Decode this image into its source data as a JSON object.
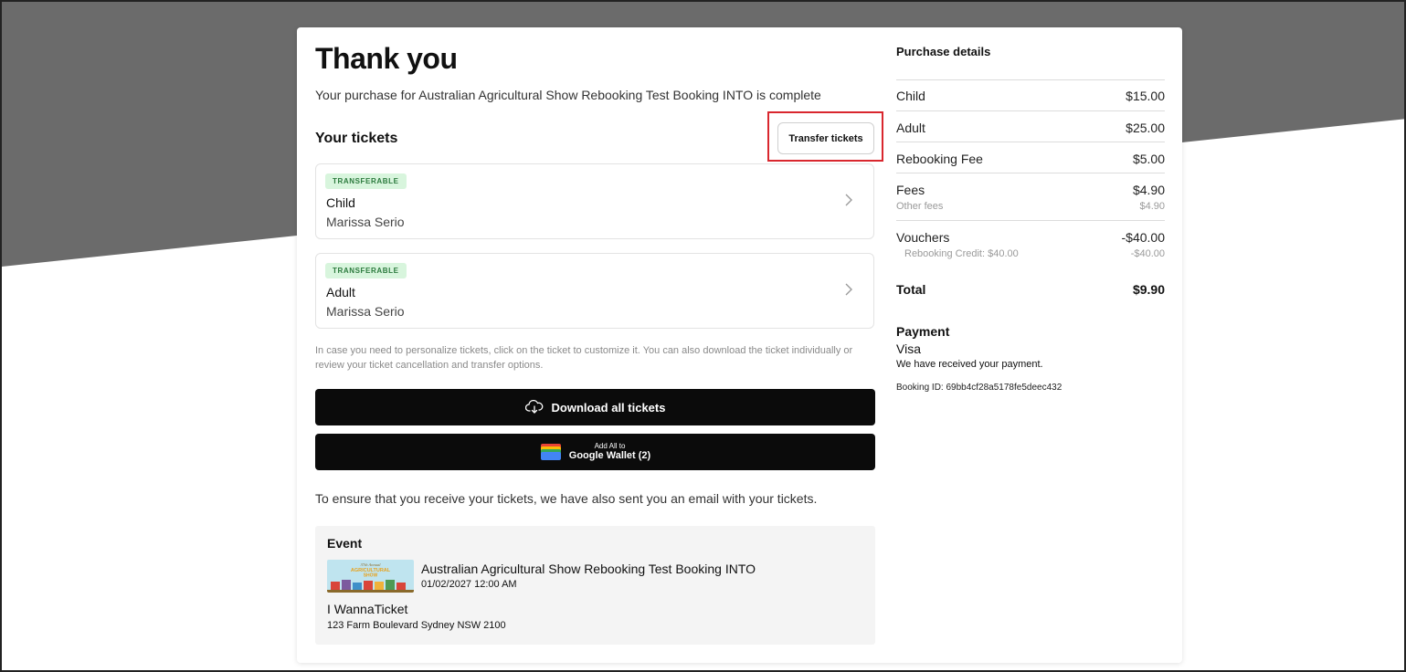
{
  "page": {
    "title": "Thank you",
    "subtitle": "Your purchase for Australian Agricultural Show Rebooking Test Booking INTO is complete"
  },
  "tickets": {
    "heading": "Your tickets",
    "transfer_label": "Transfer tickets",
    "items": [
      {
        "badge": "TRANSFERABLE",
        "type": "Child",
        "holder": "Marissa Serio"
      },
      {
        "badge": "TRANSFERABLE",
        "type": "Adult",
        "holder": "Marissa Serio"
      }
    ],
    "help_text": "In case you need to personalize tickets, click on the ticket to customize it. You can also download the ticket individually or review your ticket cancellation and transfer options.",
    "download_label": "Download all tickets",
    "wallet_small": "Add All to",
    "wallet_big": "Google Wallet (2)",
    "email_note": "To ensure that you receive your tickets, we have also sent you an email with your tickets."
  },
  "event": {
    "label": "Event",
    "name": "Australian Agricultural Show Rebooking Test Booking INTO",
    "date": "01/02/2027 12:00 AM",
    "venue": "I WannaTicket",
    "address": "123 Farm Boulevard Sydney NSW 2100",
    "thumb_line1": "37th Annual",
    "thumb_line2": "AGRICULTURAL",
    "thumb_line3": "SHOW"
  },
  "purchase": {
    "title": "Purchase details",
    "rows": [
      {
        "label": "Child",
        "amount": "$15.00"
      },
      {
        "label": "Adult",
        "amount": "$25.00"
      },
      {
        "label": "Rebooking Fee",
        "amount": "$5.00"
      },
      {
        "label": "Fees",
        "amount": "$4.90",
        "sub_label": "Other fees",
        "sub_amount": "$4.90"
      },
      {
        "label": "Vouchers",
        "amount": "-$40.00",
        "sub_label": "Rebooking Credit: $40.00",
        "sub_amount": "-$40.00"
      },
      {
        "label": "Total",
        "amount": "$9.90"
      }
    ]
  },
  "payment": {
    "title": "Payment",
    "method": "Visa",
    "note": "We have received your payment.",
    "booking_id": "Booking ID: 69bb4cf28a5178fe5deec432"
  },
  "colors": {
    "header_band": "#6b6b6b",
    "highlight_outline": "#d9272e",
    "badge_bg": "#d8f5dd",
    "badge_text": "#2b7a3d",
    "button_dark": "#0b0b0b"
  }
}
